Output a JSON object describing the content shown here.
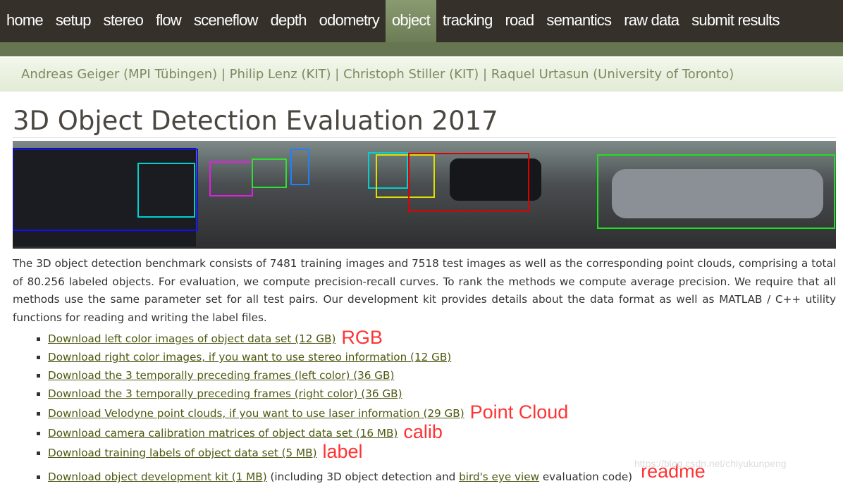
{
  "nav": {
    "items": [
      "home",
      "setup",
      "stereo",
      "flow",
      "sceneflow",
      "depth",
      "odometry",
      "object",
      "tracking",
      "road",
      "semantics",
      "raw data",
      "submit results"
    ],
    "active": "object"
  },
  "authors": "Andreas Geiger (MPI Tübingen) | Philip Lenz (KIT) | Christoph Stiller (KIT) | Raquel Urtasun (University of Toronto)",
  "title": "3D Object Detection Evaluation 2017",
  "description": "The 3D object detection benchmark consists of 7481 training images and 7518 test images as well as the corresponding point clouds, comprising a total of 80.256 labeled objects. For evaluation, we compute precision-recall curves. To rank the methods we compute average precision. We require that all methods use the same parameter set for all test pairs. Our development kit provides details about the data format as well as MATLAB / C++ utility functions for reading and writing the label files.",
  "downloads": [
    {
      "link": "Download left color images of object data set (12 GB)",
      "note": "RGB"
    },
    {
      "link": "Download right color images, if you want to use stereo information (12 GB)",
      "note": ""
    },
    {
      "link": "Download the 3 temporally preceding frames (left color) (36 GB)",
      "note": ""
    },
    {
      "link": "Download the 3 temporally preceding frames (right color) (36 GB)",
      "note": ""
    },
    {
      "link": "Download Velodyne point clouds, if you want to use laser information (29 GB)",
      "note": "Point Cloud"
    },
    {
      "link": "Download camera calibration matrices of object data set (16 MB)",
      "note": "calib"
    },
    {
      "link": "Download training labels of object data set (5 MB)",
      "note": "label"
    }
  ],
  "devkit": {
    "link": "Download object development kit (1 MB)",
    "mid": " (including 3D object detection and ",
    "link2": "bird's eye view",
    "end": " evaluation code)",
    "note": "readme"
  },
  "watermark": "https://blog.csdn.net/chiyukunpeng",
  "colors": {
    "nav_bg": "#35302a",
    "active_tab": "#7c8c62",
    "link": "#4b5a10",
    "annotation": "#ff3333"
  }
}
